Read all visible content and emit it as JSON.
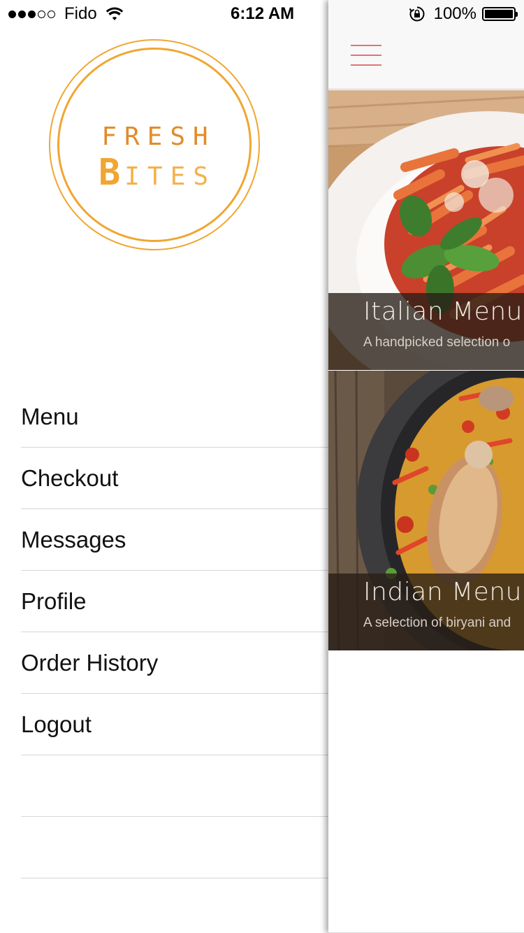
{
  "status_bar": {
    "carrier": "Fido",
    "time": "6:12 AM",
    "battery_percent": "100%",
    "signal_bars_filled": 3,
    "signal_bars_total": 5
  },
  "logo": {
    "line1": "FRESH",
    "line2_initial": "B",
    "line2_rest": "ITES",
    "color": "#f0a631"
  },
  "drawer": {
    "items": [
      {
        "label": "Menu"
      },
      {
        "label": "Checkout"
      },
      {
        "label": "Messages"
      },
      {
        "label": "Profile"
      },
      {
        "label": "Order History"
      },
      {
        "label": "Logout"
      },
      {
        "label": ""
      },
      {
        "label": ""
      }
    ]
  },
  "main": {
    "menu_icon": "hamburger-icon",
    "cards": [
      {
        "title": "Italian Menu",
        "description": "A handpicked selection o"
      },
      {
        "title": "Indian Menu",
        "description": "A selection of biryani and"
      }
    ]
  },
  "colors": {
    "accent": "#f0a631",
    "hamburger": "#e57373"
  }
}
